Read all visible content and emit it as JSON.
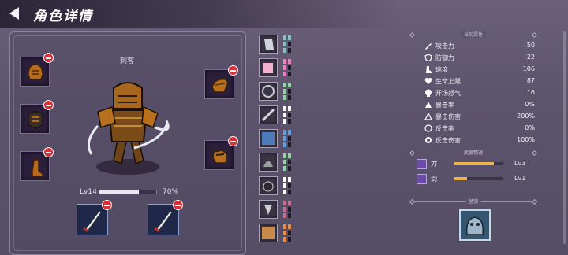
{
  "header": {
    "title": "角色详情"
  },
  "character": {
    "class_name": "刺客",
    "level_label": "Lv14",
    "xp_percent_label": "70%",
    "xp_fraction": 0.7
  },
  "equipment": {
    "left_slots": [
      "helmet",
      "chest-armor",
      "boots"
    ],
    "right_slots": [
      "shoulder-armor",
      "gauntlet"
    ],
    "weapons": [
      "dagger",
      "dagger"
    ]
  },
  "skills": [
    {
      "icon": "skill-1",
      "pip_color": "#7ec6c9"
    },
    {
      "icon": "skill-2",
      "pip_color": "#f27dc0"
    },
    {
      "icon": "skill-3",
      "pip_color": "#8fd6a0"
    },
    {
      "icon": "skill-4",
      "pip_color": "#ffffff"
    },
    {
      "icon": "skill-5",
      "pip_color": "#5aa2e6"
    },
    {
      "icon": "skill-6",
      "pip_color": "#8fd6a0"
    },
    {
      "icon": "skill-7",
      "pip_color": "#ffffff"
    },
    {
      "icon": "skill-8",
      "pip_color": "#d06a8e"
    },
    {
      "icon": "skill-9",
      "pip_color": "#f08c3a"
    }
  ],
  "stats_panel": {
    "section_title": "当前属性",
    "stats": [
      {
        "name": "攻击力",
        "value": "50",
        "icon": "sword-icon"
      },
      {
        "name": "防御力",
        "value": "22",
        "icon": "shield-icon"
      },
      {
        "name": "速度",
        "value": "106",
        "icon": "boot-icon"
      },
      {
        "name": "生命上限",
        "value": "87",
        "icon": "heart-icon"
      },
      {
        "name": "开场怒气",
        "value": "16",
        "icon": "skull-icon"
      },
      {
        "name": "暴击率",
        "value": "0%",
        "icon": "crit-icon"
      },
      {
        "name": "暴击伤害",
        "value": "200%",
        "icon": "crit-damage-icon"
      },
      {
        "name": "反击率",
        "value": "0%",
        "icon": "counter-icon"
      },
      {
        "name": "反击伤害",
        "value": "100%",
        "icon": "counter-damage-icon"
      }
    ],
    "mastery_title": "武器精通",
    "mastery": [
      {
        "name": "刀",
        "level": "Lv3",
        "fraction": 0.8
      },
      {
        "name": "剑",
        "level": "Lv1",
        "fraction": 0.25
      }
    ],
    "pet_title": "坐骑"
  }
}
